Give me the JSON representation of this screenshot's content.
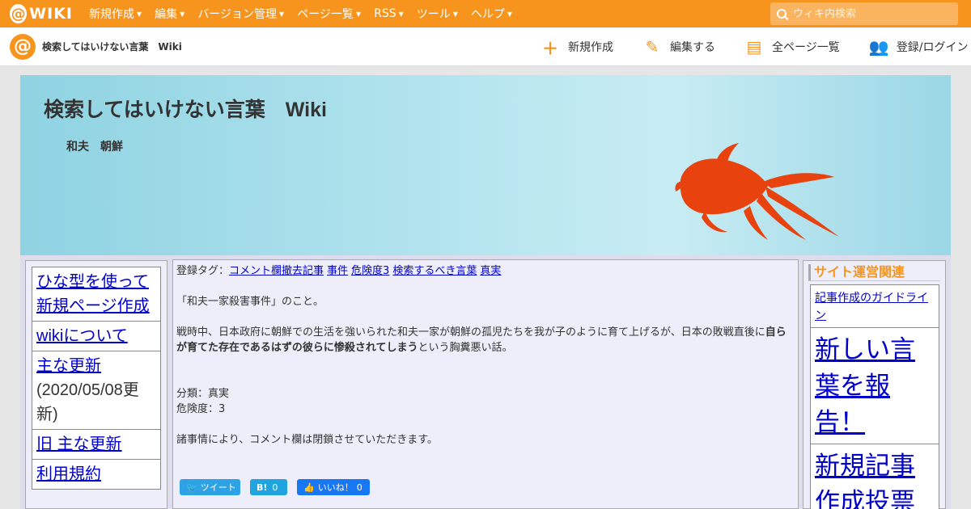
{
  "topbar": {
    "logo_text": "WIKI",
    "menu": [
      {
        "label": "新規作成"
      },
      {
        "label": "編集"
      },
      {
        "label": "バージョン管理"
      },
      {
        "label": "ページ一覧"
      },
      {
        "label": "RSS"
      },
      {
        "label": "ツール"
      },
      {
        "label": "ヘルプ"
      }
    ],
    "search_placeholder": "ウィキ内検索"
  },
  "subbar": {
    "site_title": "検索してはいけない言葉　Wiki",
    "actions": [
      {
        "label": "新規作成",
        "icon": "plus-icon"
      },
      {
        "label": "編集する",
        "icon": "pencil-icon"
      },
      {
        "label": "全ページ一覧",
        "icon": "page-list-icon"
      },
      {
        "label": "登録/ログイン",
        "icon": "user-add-icon"
      }
    ]
  },
  "banner": {
    "title": "検索してはいけない言葉　Wiki",
    "subtitle": "和夫　朝鮮"
  },
  "left_nav": {
    "items": [
      {
        "label": "ひな型を使って新規ページ作成"
      },
      {
        "label": "wikiについて"
      },
      {
        "label": "主な更新",
        "note": "(2020/05/08更新)"
      },
      {
        "label": "旧 主な更新"
      },
      {
        "label": "利用規約"
      }
    ]
  },
  "main": {
    "tags_label": "登録タグ：",
    "tags": [
      "コメント欄撤去記事",
      "事件",
      "危険度3",
      "検索するべき言葉",
      "真実"
    ],
    "intro": "「和夫一家殺害事件」のこと。",
    "body_before": "戦時中、日本政府に朝鮮での生活を強いられた和夫一家が朝鮮の孤児たちを我が子のように育て上げるが、日本の敗戦直後に",
    "body_bold": "自らが育てた存在であるはずの彼らに惨殺されてしまう",
    "body_after": "という胸糞悪い話。",
    "category": "分類：真実",
    "danger": "危険度：3",
    "notice": "諸事情により、コメント欄は閉鎖させていただきます。",
    "share": {
      "tweet": "ツイート",
      "hatena": "B!",
      "hatena_count": "0",
      "like": "いいね！",
      "like_count": "0"
    }
  },
  "right_nav": {
    "heading": "サイト運営関連",
    "items": [
      {
        "label": "記事作成のガイドライン",
        "size": "small"
      },
      {
        "label": "新しい言葉を報告！",
        "size": "big"
      },
      {
        "label": "新規記事作成投票",
        "size": "big"
      }
    ]
  },
  "colors": {
    "brand_orange": "#f7941d",
    "link_blue": "#0000cc",
    "goldfish": "#e8420f"
  }
}
